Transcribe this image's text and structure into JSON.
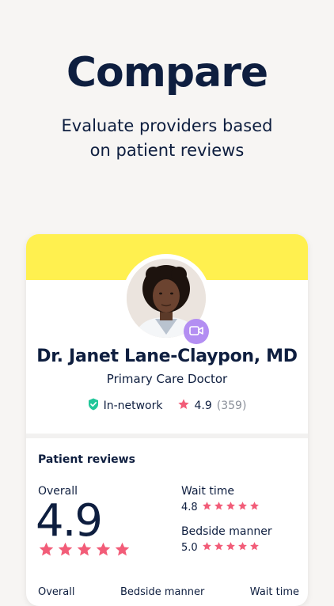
{
  "hero": {
    "title": "Compare",
    "subtitle_line1": "Evaluate providers based",
    "subtitle_line2": "on patient reviews"
  },
  "colors": {
    "band": "#fff04f",
    "star": "#f25c78",
    "navy": "#0e1e3f",
    "shield": "#22c79a",
    "video_badge": "#b38ef2"
  },
  "provider": {
    "name": "Dr. Janet Lane-Claypon, MD",
    "specialty": "Primary Care Doctor",
    "network": "In-network",
    "rating": "4.9",
    "review_count": "(359)",
    "icons": [
      "shield-check-icon",
      "star-icon",
      "video-icon"
    ]
  },
  "reviews": {
    "title": "Patient reviews",
    "overall_label": "Overall",
    "overall_value": "4.9",
    "overall_stars": 5,
    "wait_time_label": "Wait time",
    "wait_time_value": "4.8",
    "wait_time_stars": 5,
    "bedside_label": "Bedside manner",
    "bedside_value": "5.0",
    "bedside_stars": 5,
    "bottom_columns": [
      "Overall",
      "Bedside manner",
      "Wait time"
    ]
  }
}
